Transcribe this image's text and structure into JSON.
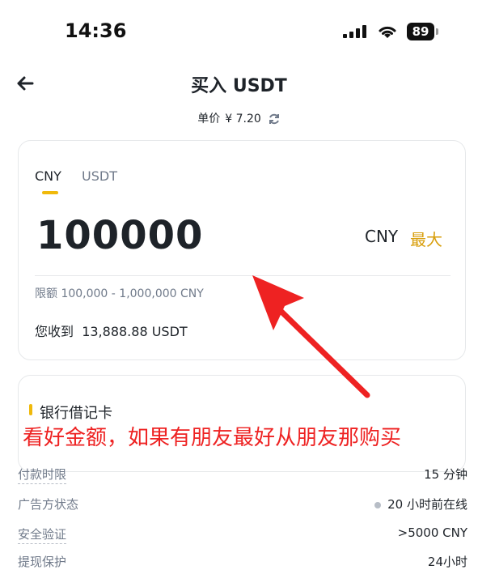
{
  "status_bar": {
    "time": "14:36",
    "battery": "89"
  },
  "nav": {
    "title": "买入 USDT"
  },
  "price": {
    "label": "单价",
    "value": "¥ 7.20"
  },
  "card": {
    "tabs": [
      {
        "label": "CNY"
      },
      {
        "label": "USDT"
      }
    ],
    "amount": "100000",
    "currency": "CNY",
    "max_label": "最大",
    "limit": "限额 100,000 - 1,000,000 CNY",
    "receive_label": "您收到",
    "receive_value": "13,888.88 USDT"
  },
  "payment": {
    "title": "银行借记卡"
  },
  "caption": "看好金额，如果有朋友最好从朋友那购买",
  "info": [
    {
      "label": "付款时限",
      "value": "15 分钟"
    },
    {
      "label": "广告方状态",
      "value": "20 小时前在线"
    },
    {
      "label": "安全验证",
      "value": ">5000 CNY"
    },
    {
      "label": "提现保护",
      "value": "24小时"
    }
  ],
  "colors": {
    "accent": "#f0b90b",
    "max": "#d89e0b",
    "annotation": "#ee2222",
    "muted": "#707a8a"
  }
}
